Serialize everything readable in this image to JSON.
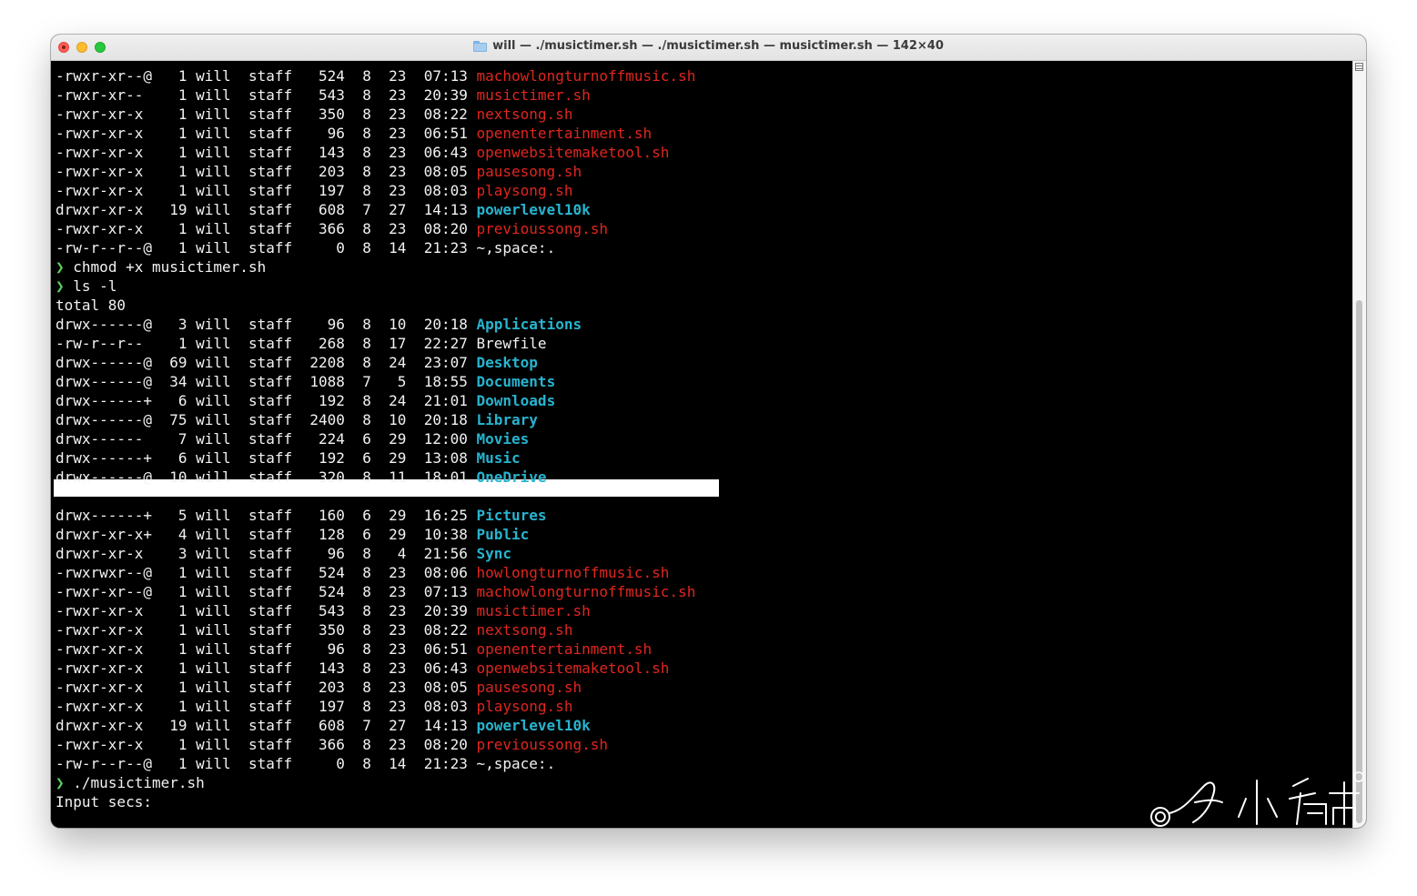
{
  "window": {
    "title": "will — ./musictimer.sh — ./musictimer.sh — musictimer.sh — 142×40"
  },
  "colors": {
    "executable": "#e0261f",
    "directory": "#27b4cf",
    "prompt": "#5fd15f",
    "text": "#f2f2f2",
    "background": "#000000"
  },
  "terminal": {
    "block1": [
      {
        "perm": "-rwxr-xr--@",
        "links": "1",
        "owner": "will",
        "group": "staff",
        "size": "524",
        "month": "8",
        "day": "23",
        "time": "07:13",
        "name": "machowlongturnoffmusic.sh",
        "kind": "exec"
      },
      {
        "perm": "-rwxr-xr--",
        "links": "1",
        "owner": "will",
        "group": "staff",
        "size": "543",
        "month": "8",
        "day": "23",
        "time": "20:39",
        "name": "musictimer.sh",
        "kind": "exec"
      },
      {
        "perm": "-rwxr-xr-x",
        "links": "1",
        "owner": "will",
        "group": "staff",
        "size": "350",
        "month": "8",
        "day": "23",
        "time": "08:22",
        "name": "nextsong.sh",
        "kind": "exec"
      },
      {
        "perm": "-rwxr-xr-x",
        "links": "1",
        "owner": "will",
        "group": "staff",
        "size": "96",
        "month": "8",
        "day": "23",
        "time": "06:51",
        "name": "openentertainment.sh",
        "kind": "exec"
      },
      {
        "perm": "-rwxr-xr-x",
        "links": "1",
        "owner": "will",
        "group": "staff",
        "size": "143",
        "month": "8",
        "day": "23",
        "time": "06:43",
        "name": "openwebsitemaketool.sh",
        "kind": "exec"
      },
      {
        "perm": "-rwxr-xr-x",
        "links": "1",
        "owner": "will",
        "group": "staff",
        "size": "203",
        "month": "8",
        "day": "23",
        "time": "08:05",
        "name": "pausesong.sh",
        "kind": "exec"
      },
      {
        "perm": "-rwxr-xr-x",
        "links": "1",
        "owner": "will",
        "group": "staff",
        "size": "197",
        "month": "8",
        "day": "23",
        "time": "08:03",
        "name": "playsong.sh",
        "kind": "exec"
      },
      {
        "perm": "drwxr-xr-x",
        "links": "19",
        "owner": "will",
        "group": "staff",
        "size": "608",
        "month": "7",
        "day": "27",
        "time": "14:13",
        "name": "powerlevel10k",
        "kind": "dir"
      },
      {
        "perm": "-rwxr-xr-x",
        "links": "1",
        "owner": "will",
        "group": "staff",
        "size": "366",
        "month": "8",
        "day": "23",
        "time": "08:20",
        "name": "previoussong.sh",
        "kind": "exec"
      },
      {
        "perm": "-rw-r--r--@",
        "links": "1",
        "owner": "will",
        "group": "staff",
        "size": "0",
        "month": "8",
        "day": "14",
        "time": "21:23",
        "name": "~,space:.",
        "kind": "plain"
      }
    ],
    "cmd1": "chmod +x musictimer.sh",
    "cmd2": "ls -l",
    "total": "total 80",
    "block2": [
      {
        "perm": "drwx------@",
        "links": "3",
        "owner": "will",
        "group": "staff",
        "size": "96",
        "month": "8",
        "day": "10",
        "time": "20:18",
        "name": "Applications",
        "kind": "dir"
      },
      {
        "perm": "-rw-r--r--",
        "links": "1",
        "owner": "will",
        "group": "staff",
        "size": "268",
        "month": "8",
        "day": "17",
        "time": "22:27",
        "name": "Brewfile",
        "kind": "plain"
      },
      {
        "perm": "drwx------@",
        "links": "69",
        "owner": "will",
        "group": "staff",
        "size": "2208",
        "month": "8",
        "day": "24",
        "time": "23:07",
        "name": "Desktop",
        "kind": "dir"
      },
      {
        "perm": "drwx------@",
        "links": "34",
        "owner": "will",
        "group": "staff",
        "size": "1088",
        "month": "7",
        "day": "5",
        "time": "18:55",
        "name": "Documents",
        "kind": "dir"
      },
      {
        "perm": "drwx------+",
        "links": "6",
        "owner": "will",
        "group": "staff",
        "size": "192",
        "month": "8",
        "day": "24",
        "time": "21:01",
        "name": "Downloads",
        "kind": "dir"
      },
      {
        "perm": "drwx------@",
        "links": "75",
        "owner": "will",
        "group": "staff",
        "size": "2400",
        "month": "8",
        "day": "10",
        "time": "20:18",
        "name": "Library",
        "kind": "dir"
      },
      {
        "perm": "drwx------",
        "links": "7",
        "owner": "will",
        "group": "staff",
        "size": "224",
        "month": "6",
        "day": "29",
        "time": "12:00",
        "name": "Movies",
        "kind": "dir"
      },
      {
        "perm": "drwx------+",
        "links": "6",
        "owner": "will",
        "group": "staff",
        "size": "192",
        "month": "6",
        "day": "29",
        "time": "13:08",
        "name": "Music",
        "kind": "dir"
      },
      {
        "perm": "drwx------@",
        "links": "10",
        "owner": "will",
        "group": "staff",
        "size": "320",
        "month": "8",
        "day": "11",
        "time": "18:01",
        "name": "OneDrive",
        "kind": "dir"
      }
    ],
    "block3": [
      {
        "perm": "drwx------+",
        "links": "5",
        "owner": "will",
        "group": "staff",
        "size": "160",
        "month": "6",
        "day": "29",
        "time": "16:25",
        "name": "Pictures",
        "kind": "dir"
      },
      {
        "perm": "drwxr-xr-x+",
        "links": "4",
        "owner": "will",
        "group": "staff",
        "size": "128",
        "month": "6",
        "day": "29",
        "time": "10:38",
        "name": "Public",
        "kind": "dir"
      },
      {
        "perm": "drwxr-xr-x",
        "links": "3",
        "owner": "will",
        "group": "staff",
        "size": "96",
        "month": "8",
        "day": "4",
        "time": "21:56",
        "name": "Sync",
        "kind": "dir"
      },
      {
        "perm": "-rwxrwxr--@",
        "links": "1",
        "owner": "will",
        "group": "staff",
        "size": "524",
        "month": "8",
        "day": "23",
        "time": "08:06",
        "name": "howlongturnoffmusic.sh",
        "kind": "exec"
      },
      {
        "perm": "-rwxr-xr--@",
        "links": "1",
        "owner": "will",
        "group": "staff",
        "size": "524",
        "month": "8",
        "day": "23",
        "time": "07:13",
        "name": "machowlongturnoffmusic.sh",
        "kind": "exec"
      },
      {
        "perm": "-rwxr-xr-x",
        "links": "1",
        "owner": "will",
        "group": "staff",
        "size": "543",
        "month": "8",
        "day": "23",
        "time": "20:39",
        "name": "musictimer.sh",
        "kind": "exec"
      },
      {
        "perm": "-rwxr-xr-x",
        "links": "1",
        "owner": "will",
        "group": "staff",
        "size": "350",
        "month": "8",
        "day": "23",
        "time": "08:22",
        "name": "nextsong.sh",
        "kind": "exec"
      },
      {
        "perm": "-rwxr-xr-x",
        "links": "1",
        "owner": "will",
        "group": "staff",
        "size": "96",
        "month": "8",
        "day": "23",
        "time": "06:51",
        "name": "openentertainment.sh",
        "kind": "exec"
      },
      {
        "perm": "-rwxr-xr-x",
        "links": "1",
        "owner": "will",
        "group": "staff",
        "size": "143",
        "month": "8",
        "day": "23",
        "time": "06:43",
        "name": "openwebsitemaketool.sh",
        "kind": "exec"
      },
      {
        "perm": "-rwxr-xr-x",
        "links": "1",
        "owner": "will",
        "group": "staff",
        "size": "203",
        "month": "8",
        "day": "23",
        "time": "08:05",
        "name": "pausesong.sh",
        "kind": "exec"
      },
      {
        "perm": "-rwxr-xr-x",
        "links": "1",
        "owner": "will",
        "group": "staff",
        "size": "197",
        "month": "8",
        "day": "23",
        "time": "08:03",
        "name": "playsong.sh",
        "kind": "exec"
      },
      {
        "perm": "drwxr-xr-x",
        "links": "19",
        "owner": "will",
        "group": "staff",
        "size": "608",
        "month": "7",
        "day": "27",
        "time": "14:13",
        "name": "powerlevel10k",
        "kind": "dir"
      },
      {
        "perm": "-rwxr-xr-x",
        "links": "1",
        "owner": "will",
        "group": "staff",
        "size": "366",
        "month": "8",
        "day": "23",
        "time": "08:20",
        "name": "previoussong.sh",
        "kind": "exec"
      },
      {
        "perm": "-rw-r--r--@",
        "links": "1",
        "owner": "will",
        "group": "staff",
        "size": "0",
        "month": "8",
        "day": "14",
        "time": "21:23",
        "name": "~,space:.",
        "kind": "plain"
      }
    ],
    "prompt_symbol": "❯",
    "cmd3": "./musictimer.sh",
    "input_prompt": "Input secs:"
  }
}
